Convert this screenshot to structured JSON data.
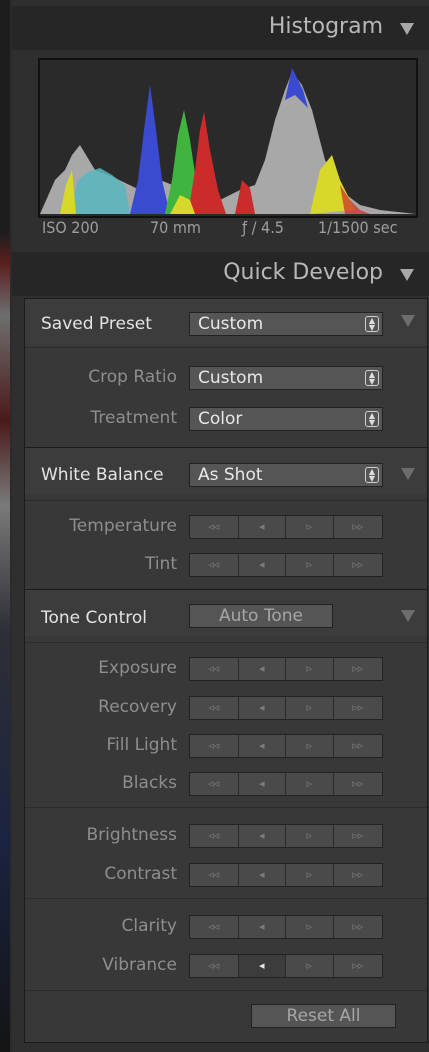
{
  "histogram": {
    "title": "Histogram",
    "iso": "ISO 200",
    "focal_length": "70 mm",
    "aperture": "ƒ / 4.5",
    "shutter": "1/1500 sec"
  },
  "quick_develop": {
    "title": "Quick Develop",
    "saved_preset": {
      "label": "Saved Preset",
      "value": "Custom"
    },
    "crop_ratio": {
      "label": "Crop Ratio",
      "value": "Custom"
    },
    "treatment": {
      "label": "Treatment",
      "value": "Color"
    },
    "white_balance": {
      "label": "White Balance",
      "value": "As Shot"
    },
    "temperature": {
      "label": "Temperature"
    },
    "tint": {
      "label": "Tint"
    },
    "tone_control": {
      "label": "Tone Control",
      "auto_tone": "Auto Tone"
    },
    "exposure": {
      "label": "Exposure"
    },
    "recovery": {
      "label": "Recovery"
    },
    "fill_light": {
      "label": "Fill Light"
    },
    "blacks": {
      "label": "Blacks"
    },
    "brightness": {
      "label": "Brightness"
    },
    "contrast": {
      "label": "Contrast"
    },
    "clarity": {
      "label": "Clarity"
    },
    "vibrance": {
      "label": "Vibrance"
    },
    "reset_all": "Reset All"
  },
  "stepper_glyphs": {
    "big_left": "◃◃",
    "left": "◂",
    "right": "▹",
    "big_right": "▹▹"
  },
  "colors": {
    "panel": "#2f2f2f",
    "box": "#383838",
    "histogram_blue": "#3a4bd0",
    "histogram_green": "#3fb43f",
    "histogram_red": "#cc2b2b",
    "histogram_yellow": "#d8d82a",
    "histogram_gray": "#a9a9a9"
  }
}
